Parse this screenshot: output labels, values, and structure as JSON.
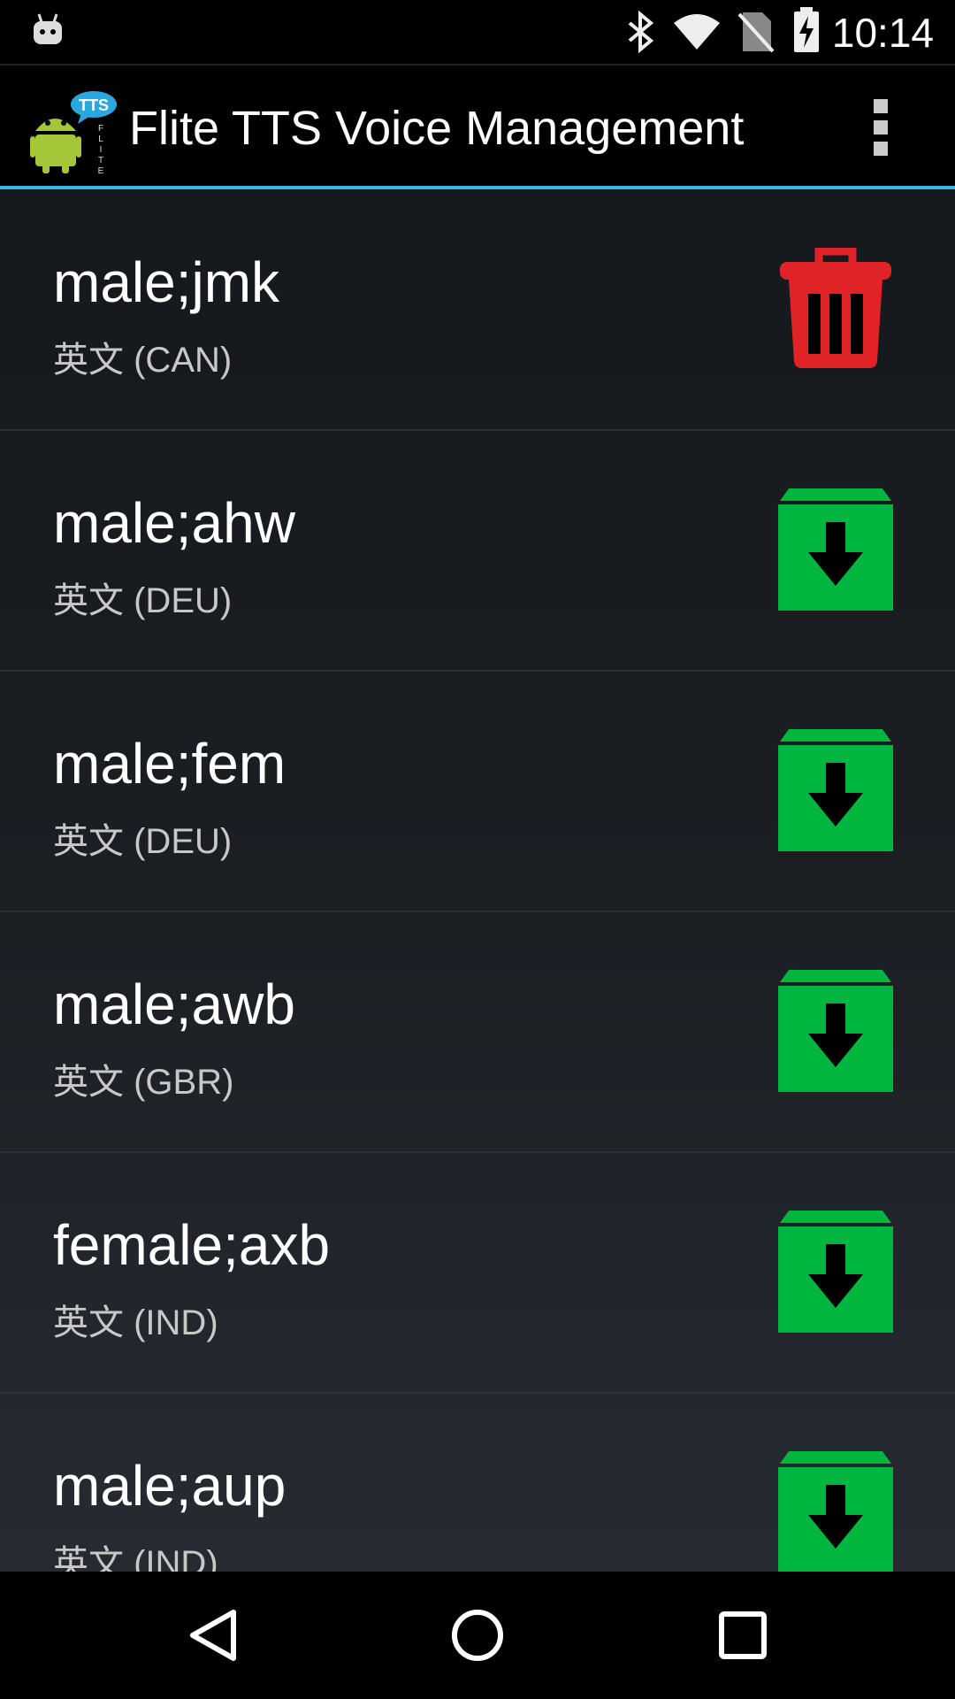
{
  "status_bar": {
    "time": "10:14",
    "icons": [
      "android-notification-icon",
      "bluetooth-icon",
      "wifi-icon",
      "no-sim-icon",
      "battery-charging-icon"
    ]
  },
  "action_bar": {
    "title": "Flite TTS Voice Management",
    "app_icon": "flite-tts-app-icon",
    "app_icon_text": "TTS",
    "menu_icon": "overflow-menu-icon"
  },
  "voices": [
    {
      "name": "male;jmk",
      "lang": "英文 (CAN)",
      "action": "delete",
      "action_icon": "trash-icon"
    },
    {
      "name": "male;ahw",
      "lang": "英文 (DEU)",
      "action": "download",
      "action_icon": "download-icon"
    },
    {
      "name": "male;fem",
      "lang": "英文 (DEU)",
      "action": "download",
      "action_icon": "download-icon"
    },
    {
      "name": "male;awb",
      "lang": "英文 (GBR)",
      "action": "download",
      "action_icon": "download-icon"
    },
    {
      "name": "female;axb",
      "lang": "英文 (IND)",
      "action": "download",
      "action_icon": "download-icon"
    },
    {
      "name": "male;aup",
      "lang": "英文 (IND)",
      "action": "download",
      "action_icon": "download-icon"
    }
  ],
  "nav_bar": {
    "icons": [
      "back-icon",
      "home-icon",
      "recents-icon"
    ]
  },
  "colors": {
    "accent": "#33b5e5",
    "delete": "#e02326",
    "download": "#00b63f"
  }
}
